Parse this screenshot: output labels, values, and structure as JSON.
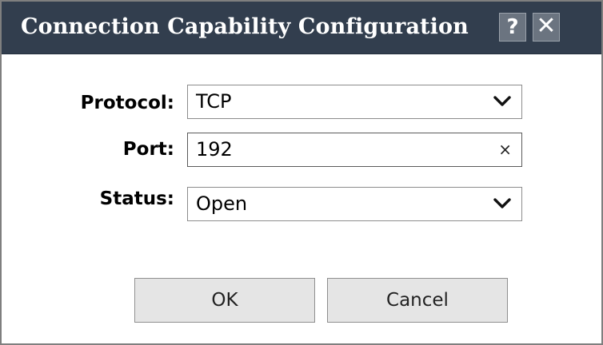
{
  "dialog": {
    "title": "Connection Capability Configuration",
    "help_label": "?",
    "close_label": "✕"
  },
  "fields": {
    "protocol": {
      "label": "Protocol:",
      "value": "TCP",
      "icon": "chevron-down-icon"
    },
    "port": {
      "label": "Port:",
      "value": "192",
      "clear_label": "×",
      "icon": "clear-icon"
    },
    "status": {
      "label": "Status:",
      "value": "Open",
      "icon": "chevron-down-icon"
    }
  },
  "buttons": {
    "ok_label": "OK",
    "cancel_label": "Cancel"
  },
  "colors": {
    "titlebar": "#323e4e",
    "button_face": "#e5e5e5",
    "border": "#7f7f7f"
  }
}
